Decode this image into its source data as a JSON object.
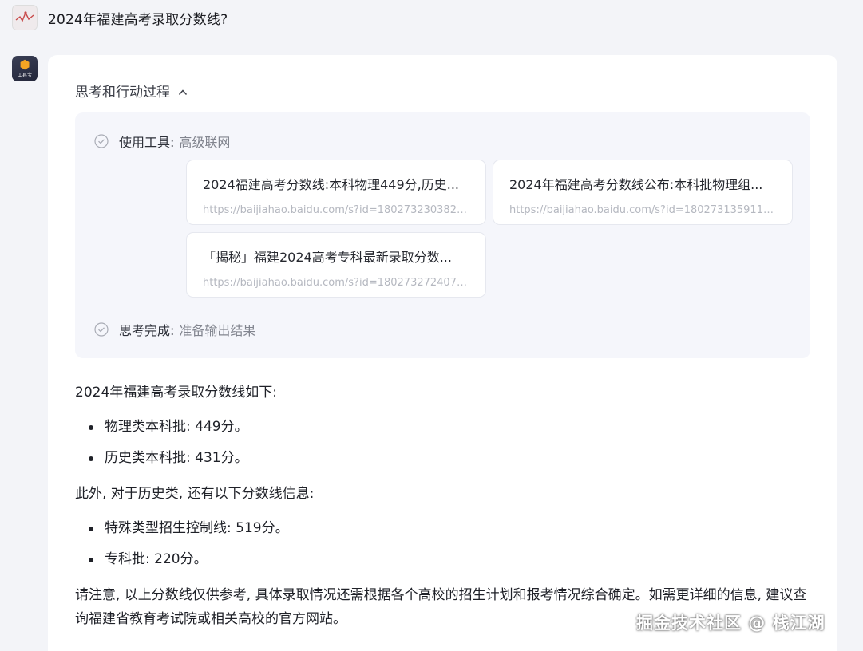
{
  "user": {
    "question": "2024年福建高考录取分数线?"
  },
  "bot": {
    "avatar_tag": "工具宝"
  },
  "thinking": {
    "header": "思考和行动过程",
    "steps": [
      {
        "key": "使用工具:",
        "value": "高级联网"
      },
      {
        "key": "思考完成:",
        "value": "准备输出结果"
      }
    ],
    "sources": [
      {
        "title": "2024福建高考分数线:本科物理449分,历史...",
        "url": "https://baijiahao.baidu.com/s?id=1802732303824..."
      },
      {
        "title": "2024年福建高考分数线公布:本科批物理组...",
        "url": "https://baijiahao.baidu.com/s?id=1802731359117..."
      },
      {
        "title": "「揭秘」福建2024高考专科最新录取分数...",
        "url": "https://baijiahao.baidu.com/s?id=1802732724073..."
      }
    ]
  },
  "answer": {
    "intro": "2024年福建高考录取分数线如下:",
    "list1": [
      "物理类本科批: 449分。",
      "历史类本科批: 431分。"
    ],
    "middle": "此外, 对于历史类, 还有以下分数线信息:",
    "list2": [
      "特殊类型招生控制线: 519分。",
      "专科批: 220分。"
    ],
    "note": "请注意, 以上分数线仅供参考, 具体录取情况还需根据各个高校的招生计划和报考情况综合确定。如需更详细的信息, 建议查询福建省教育考试院或相关高校的官方网站。"
  },
  "watermark": "掘金技术社区 @ 栈江湖",
  "colors": {
    "page_bg": "#f3f4f8",
    "card_bg": "#ffffff",
    "panel_bg": "#f5f6fb",
    "accent": "#f5a524"
  }
}
